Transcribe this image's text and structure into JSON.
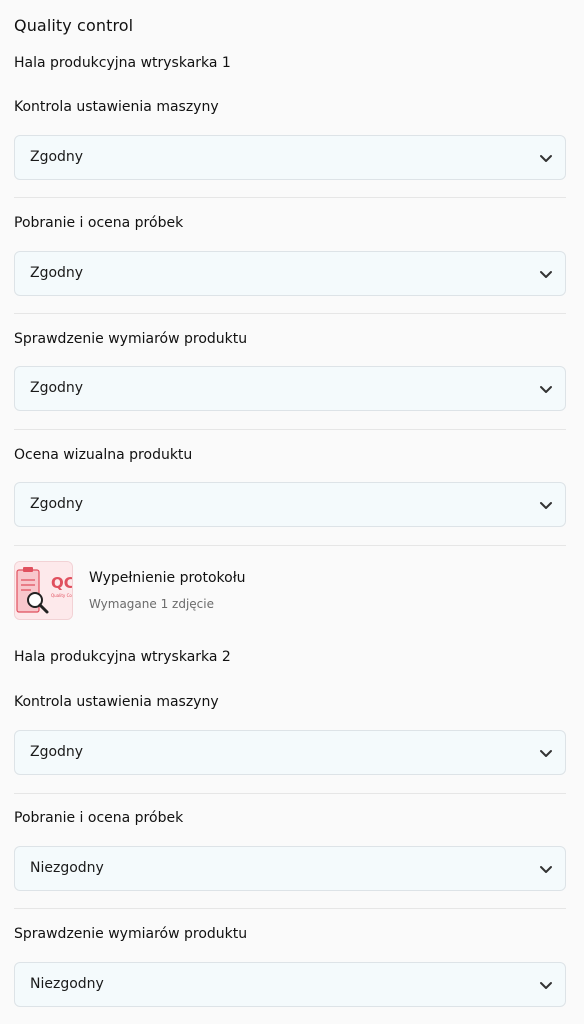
{
  "header": {
    "title": "Quality control"
  },
  "sections": [
    {
      "title": "Hala produkcyjna wtryskarka 1",
      "fields": [
        {
          "label": "Kontrola ustawienia maszyny",
          "value": "Zgodny"
        },
        {
          "label": "Pobranie i ocena próbek",
          "value": "Zgodny"
        },
        {
          "label": "Sprawdzenie wymiarów produktu",
          "value": "Zgodny"
        },
        {
          "label": "Ocena wizualna produktu",
          "value": "Zgodny"
        }
      ],
      "photo": {
        "title": "Wypełnienie protokołu",
        "subtitle": "Wymagane 1 zdjęcie",
        "thumb_text": "QC",
        "thumb_subtext": "Quality Co"
      }
    },
    {
      "title": "Hala produkcyjna wtryskarka 2",
      "fields": [
        {
          "label": "Kontrola ustawienia maszyny",
          "value": "Zgodny"
        },
        {
          "label": "Pobranie i ocena próbek",
          "value": "Niezgodny"
        },
        {
          "label": "Sprawdzenie wymiarów produktu",
          "value": "Niezgodny"
        }
      ]
    }
  ],
  "icons": {
    "select_chevron": "chevron-down-icon",
    "thumb_icon": "magnifier-document-icon"
  },
  "colors": {
    "accent": "#e0505e",
    "select_bg": "#f4fafc"
  }
}
